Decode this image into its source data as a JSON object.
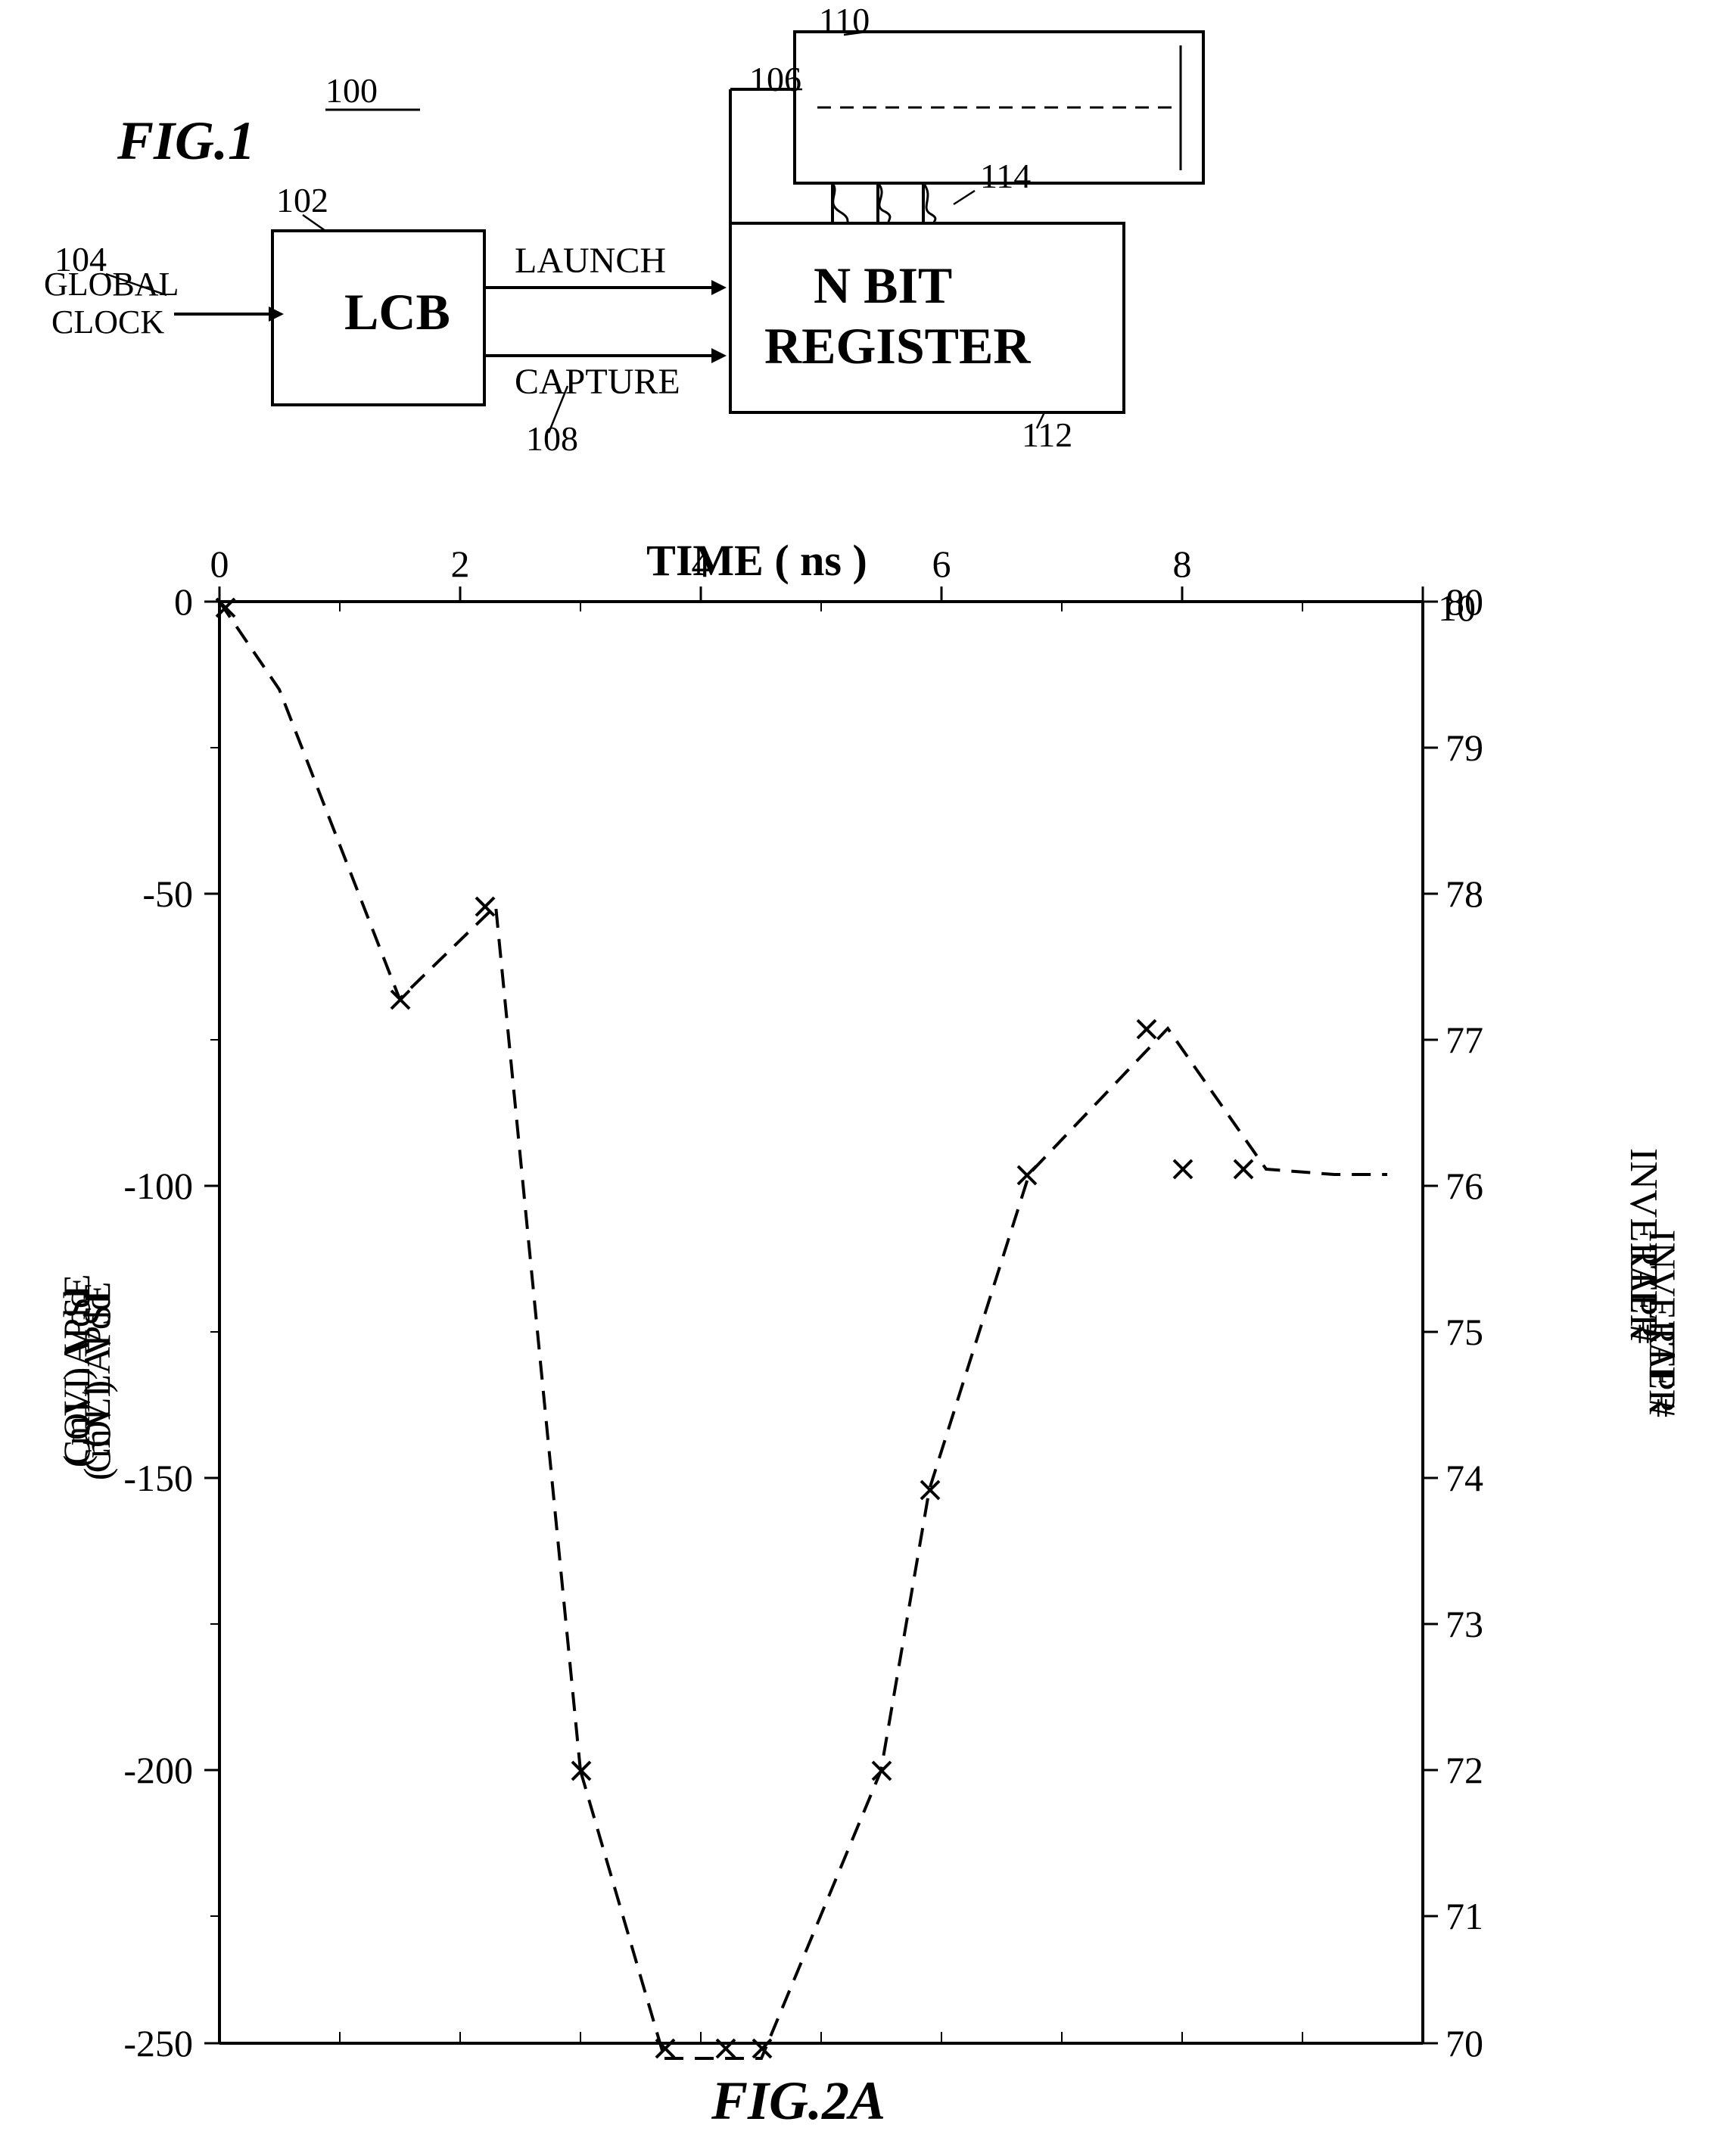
{
  "page": {
    "background": "#ffffff",
    "title": "Patent Drawing FIG.1 and FIG.2A"
  },
  "fig1": {
    "label": "FIG.1",
    "ref100": "100",
    "ref102": "102",
    "ref104": "104",
    "ref106": "106",
    "ref108": "108",
    "ref110": "110",
    "ref112": "112",
    "ref114": "114",
    "lcb_label": "LCB",
    "nbit_label1": "N BIT",
    "nbit_label2": "REGISTER",
    "global_clock1": "GLOBAL",
    "global_clock2": "CLOCK",
    "launch_label": "LAUNCH",
    "capture_label": "CAPTURE"
  },
  "fig2a": {
    "label": "FIG.2A",
    "x_axis_title": "TIME ( ns )",
    "y_left_label1": "Vdd",
    "y_left_label2": "COLLAPSE",
    "y_left_label3": "( mV )",
    "y_right_label": "INVERTER TAP #",
    "x_ticks": [
      "0",
      "2",
      "4",
      "6",
      "8",
      "10"
    ],
    "y_left_ticks": [
      "0",
      "-50",
      "-100",
      "-150",
      "-200",
      "-250"
    ],
    "y_right_ticks": [
      "80",
      "79",
      "78",
      "77",
      "76",
      "75",
      "74",
      "73",
      "72",
      "71",
      "70"
    ]
  }
}
